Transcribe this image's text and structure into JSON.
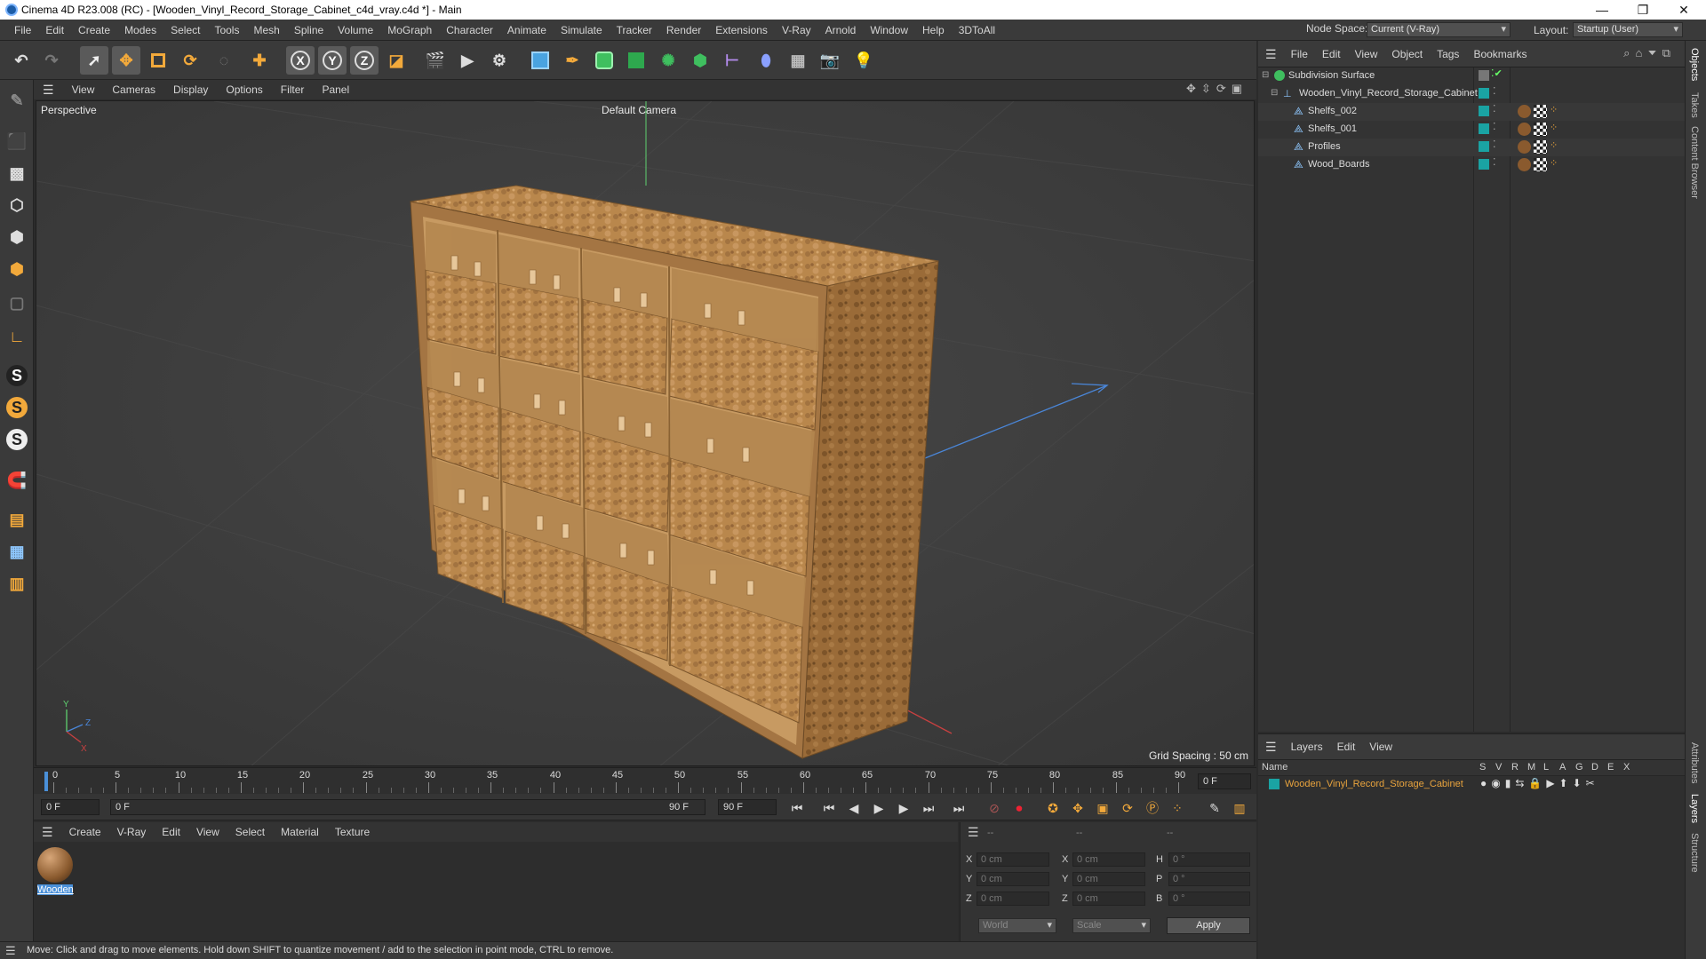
{
  "window": {
    "title": "Cinema 4D R23.008 (RC) - [Wooden_Vinyl_Record_Storage_Cabinet_c4d_vray.c4d *] - Main",
    "minimize": "—",
    "maximize": "❐",
    "close": "✕"
  },
  "menubar": {
    "items": [
      "File",
      "Edit",
      "Create",
      "Modes",
      "Select",
      "Tools",
      "Mesh",
      "Spline",
      "Volume",
      "MoGraph",
      "Character",
      "Animate",
      "Simulate",
      "Tracker",
      "Render",
      "Extensions",
      "V-Ray",
      "Arnold",
      "Window",
      "Help",
      "3DToAll"
    ],
    "node_space_label": "Node Space:",
    "node_space_value": "Current (V-Ray)",
    "layout_label": "Layout:",
    "layout_value": "Startup (User)"
  },
  "viewport": {
    "menu": [
      "View",
      "Cameras",
      "Display",
      "Options",
      "Filter",
      "Panel"
    ],
    "projection": "Perspective",
    "camera": "Default Camera",
    "grid_spacing": "Grid Spacing : 50 cm",
    "axis": {
      "y": "Y",
      "z": "Z",
      "x": "X"
    }
  },
  "timeline": {
    "ticks": [
      "0",
      "5",
      "10",
      "15",
      "20",
      "25",
      "30",
      "35",
      "40",
      "45",
      "50",
      "55",
      "60",
      "65",
      "70",
      "75",
      "80",
      "85",
      "90"
    ],
    "frame_end_field": "0 F",
    "start_field": "0 F",
    "range_start": "0 F",
    "range_end": "90 F",
    "end_field": "90 F"
  },
  "materials": {
    "menu": [
      "Create",
      "V-Ray",
      "Edit",
      "View",
      "Select",
      "Material",
      "Texture"
    ],
    "items": [
      {
        "name": "Wooden"
      }
    ]
  },
  "coordinates": {
    "headers": [
      "--",
      "--",
      "--"
    ],
    "rows": [
      {
        "l1": "X",
        "v1": "0 cm",
        "l2": "X",
        "v2": "0 cm",
        "l3": "H",
        "v3": "0 °"
      },
      {
        "l1": "Y",
        "v1": "0 cm",
        "l2": "Y",
        "v2": "0 cm",
        "l3": "P",
        "v3": "0 °"
      },
      {
        "l1": "Z",
        "v1": "0 cm",
        "l2": "Z",
        "v2": "0 cm",
        "l3": "B",
        "v3": "0 °"
      }
    ],
    "mode": "World",
    "transform": "Scale",
    "apply": "Apply"
  },
  "status": "Move: Click and drag to move elements. Hold down SHIFT to quantize movement / add to the selection in point mode, CTRL to remove.",
  "objects": {
    "menu": [
      "File",
      "Edit",
      "View",
      "Object",
      "Tags",
      "Bookmarks"
    ],
    "rows": [
      {
        "name": "Subdivision Surface",
        "indent": 0
      },
      {
        "name": "Wooden_Vinyl_Record_Storage_Cabinet",
        "indent": 1
      },
      {
        "name": "Shelfs_002",
        "indent": 2
      },
      {
        "name": "Shelfs_001",
        "indent": 2
      },
      {
        "name": "Profiles",
        "indent": 2
      },
      {
        "name": "Wood_Boards",
        "indent": 2
      }
    ]
  },
  "layers": {
    "menu": [
      "Layers",
      "Edit",
      "View"
    ],
    "columns": [
      "Name",
      "S",
      "V",
      "R",
      "M",
      "L",
      "A",
      "G",
      "D",
      "E",
      "X"
    ],
    "rows": [
      {
        "name": "Wooden_Vinyl_Record_Storage_Cabinet",
        "color": "#1aa3a3"
      }
    ]
  },
  "right_tabs": [
    "Objects",
    "Takes",
    "Content Browser",
    "Attributes",
    "Layers",
    "Structure"
  ],
  "colors": {
    "accent": "#e8a33d",
    "selection": "#4a90d9",
    "layer_name": "#e8a33d"
  }
}
